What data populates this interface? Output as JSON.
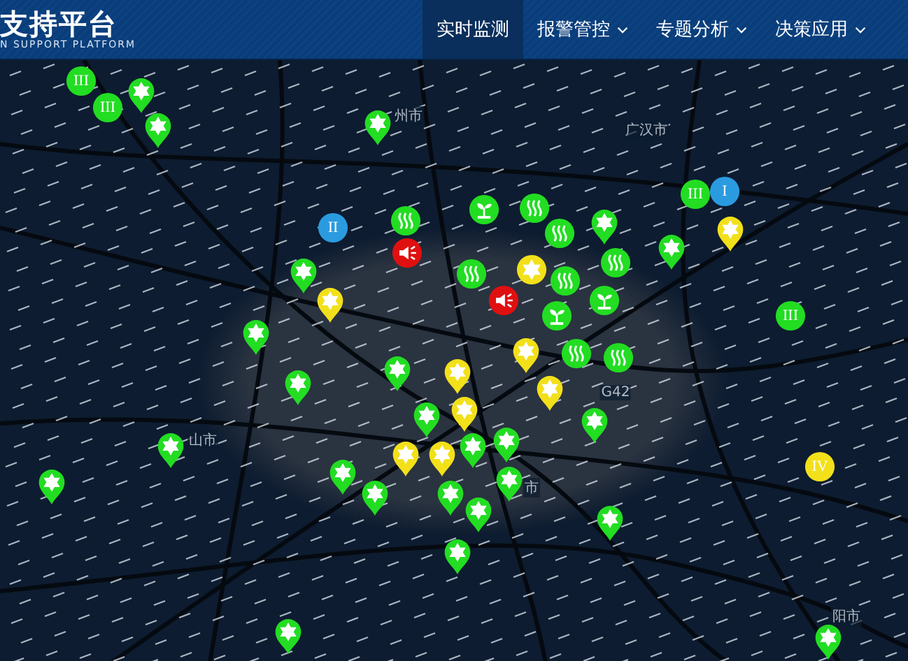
{
  "header": {
    "title": "支持平台",
    "subtitle": "N SUPPORT PLATFORM"
  },
  "nav": [
    {
      "label": "实时监测",
      "selected": true,
      "dropdown": false
    },
    {
      "label": "报警管控",
      "selected": false,
      "dropdown": true
    },
    {
      "label": "专题分析",
      "selected": false,
      "dropdown": true
    },
    {
      "label": "决策应用",
      "selected": false,
      "dropdown": true
    }
  ],
  "map": {
    "labels": [
      {
        "text": "州市"
      },
      {
        "text": "广汉市"
      },
      {
        "text": "山市"
      },
      {
        "text": "市"
      },
      {
        "text": "阳市"
      },
      {
        "text": "G42"
      }
    ],
    "markers": [
      {
        "kind": "numeral",
        "text": "III",
        "color": "#22dd22"
      },
      {
        "kind": "numeral",
        "text": "III",
        "color": "#22dd22"
      },
      {
        "kind": "star-pin",
        "color": "#22dd22"
      },
      {
        "kind": "star-pin",
        "color": "#22dd22"
      },
      {
        "kind": "star-pin",
        "color": "#22dd22"
      },
      {
        "kind": "numeral",
        "text": "III",
        "color": "#22dd22"
      },
      {
        "kind": "numeral",
        "text": "I",
        "color": "#2b9be0"
      },
      {
        "kind": "numeral",
        "text": "II",
        "color": "#2b9be0"
      },
      {
        "kind": "steam",
        "color": "#22dd22"
      },
      {
        "kind": "plant",
        "color": "#22dd22"
      },
      {
        "kind": "steam",
        "color": "#22dd22"
      },
      {
        "kind": "steam",
        "color": "#22dd22"
      },
      {
        "kind": "star-pin",
        "color": "#22dd22"
      },
      {
        "kind": "star-pin",
        "color": "#f2e01a"
      },
      {
        "kind": "star-pin",
        "color": "#22dd22"
      },
      {
        "kind": "speaker",
        "color": "#e01010"
      },
      {
        "kind": "steam",
        "color": "#22dd22"
      },
      {
        "kind": "star-pin",
        "color": "#22dd22"
      },
      {
        "kind": "star-pin",
        "color": "#f2e01a"
      },
      {
        "kind": "star-dot",
        "color": "#f2e01a"
      },
      {
        "kind": "steam",
        "color": "#22dd22"
      },
      {
        "kind": "speaker",
        "color": "#e01010"
      },
      {
        "kind": "steam",
        "color": "#22dd22"
      },
      {
        "kind": "plant",
        "color": "#22dd22"
      },
      {
        "kind": "plant",
        "color": "#22dd22"
      },
      {
        "kind": "star-pin",
        "color": "#22dd22"
      },
      {
        "kind": "star-pin",
        "color": "#f2e01a"
      },
      {
        "kind": "steam",
        "color": "#22dd22"
      },
      {
        "kind": "steam",
        "color": "#22dd22"
      },
      {
        "kind": "numeral",
        "text": "III",
        "color": "#22dd22"
      },
      {
        "kind": "star-pin",
        "color": "#22dd22"
      },
      {
        "kind": "star-pin",
        "color": "#f2e01a"
      },
      {
        "kind": "star-pin",
        "color": "#22dd22"
      },
      {
        "kind": "star-pin",
        "color": "#f2e01a"
      },
      {
        "kind": "star-pin",
        "color": "#f2e01a"
      },
      {
        "kind": "star-pin",
        "color": "#22dd22"
      },
      {
        "kind": "star-pin",
        "color": "#22dd22"
      },
      {
        "kind": "star-pin",
        "color": "#22dd22"
      },
      {
        "kind": "star-pin",
        "color": "#f2e01a"
      },
      {
        "kind": "star-pin",
        "color": "#f2e01a"
      },
      {
        "kind": "star-pin",
        "color": "#22dd22"
      },
      {
        "kind": "star-pin",
        "color": "#22dd22"
      },
      {
        "kind": "numeral",
        "text": "IV",
        "color": "#f2e01a"
      },
      {
        "kind": "star-pin",
        "color": "#22dd22"
      },
      {
        "kind": "star-pin",
        "color": "#22dd22"
      },
      {
        "kind": "star-pin",
        "color": "#22dd22"
      },
      {
        "kind": "star-pin",
        "color": "#22dd22"
      },
      {
        "kind": "star-pin",
        "color": "#22dd22"
      },
      {
        "kind": "star-pin",
        "color": "#22dd22"
      },
      {
        "kind": "star-pin",
        "color": "#22dd22"
      },
      {
        "kind": "star-pin",
        "color": "#22dd22"
      },
      {
        "kind": "star-pin",
        "color": "#22dd22"
      },
      {
        "kind": "star-pin",
        "color": "#22dd22"
      }
    ]
  }
}
